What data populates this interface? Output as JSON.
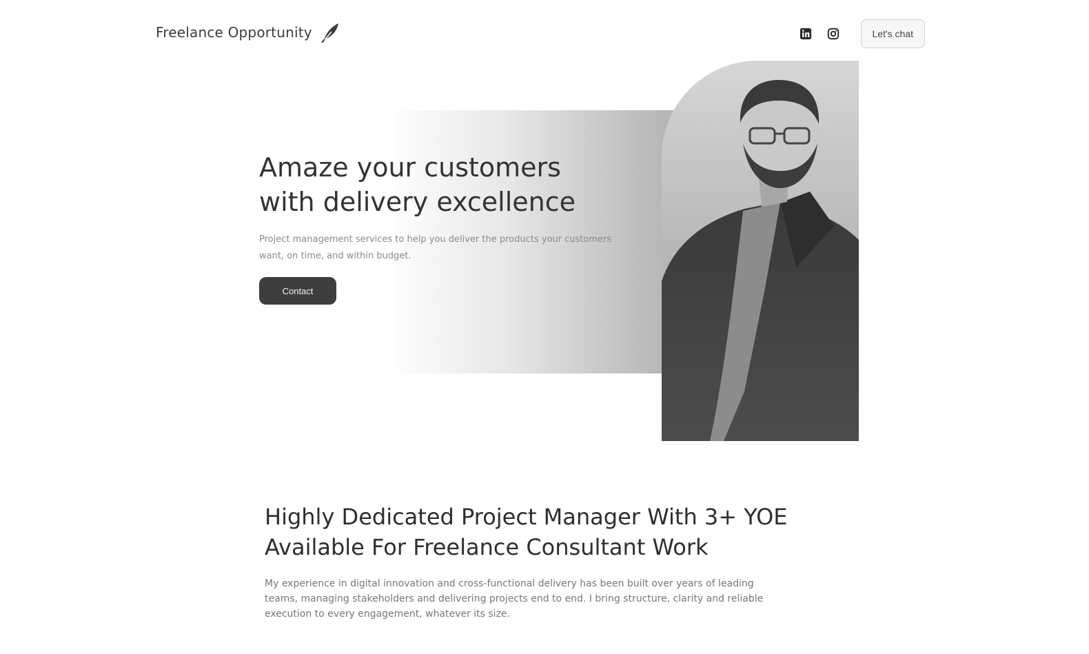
{
  "header": {
    "brand_name": "Freelance Opportunity",
    "brand_icon": "feather-pen-icon",
    "social_icons": [
      "linkedin-icon",
      "instagram-icon"
    ],
    "button_label": "Let's chat"
  },
  "hero": {
    "title": "Amaze your customers with delivery excellence",
    "subtitle": "Project management services to help you deliver the products your customers want, on time, and within budget.",
    "cta_label": "Contact"
  },
  "about": {
    "title": "Highly Dedicated Project Manager With 3+ YOE Available For Freelance Consultant Work",
    "text": "My experience in digital innovation and cross-functional delivery has been built over years of leading teams, managing stakeholders and delivering projects end to end. I bring structure, clarity and reliable execution to every engagement, whatever its size."
  },
  "colors": {
    "accent_dark": "#3e3e3e",
    "text_dark": "#2e2e2e",
    "text_muted": "#8a8a8a"
  }
}
